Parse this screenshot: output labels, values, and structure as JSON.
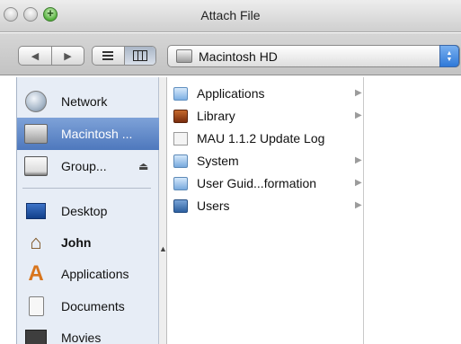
{
  "window": {
    "title": "Attach File"
  },
  "toolbar": {
    "back_glyph": "◀",
    "forward_glyph": "▶",
    "location": "Macintosh HD",
    "stepper_up": "▲",
    "stepper_down": "▼"
  },
  "sidebar": {
    "items": [
      {
        "label": "Network",
        "icon": "network-globe-icon"
      },
      {
        "label": "Macintosh ...",
        "icon": "hard-drive-icon",
        "selected": true
      },
      {
        "label": "Group...",
        "icon": "external-drive-icon",
        "eject": "⏏"
      },
      {
        "label": "Desktop",
        "icon": "desktop-icon"
      },
      {
        "label": "John",
        "icon": "home-icon"
      },
      {
        "label": "Applications",
        "icon": "applications-icon"
      },
      {
        "label": "Documents",
        "icon": "documents-icon"
      },
      {
        "label": "Movies",
        "icon": "movies-icon"
      }
    ]
  },
  "column": {
    "items": [
      {
        "label": "Applications",
        "icon": "applications-folder-icon",
        "has_children": true
      },
      {
        "label": "Library",
        "icon": "library-folder-icon",
        "has_children": true
      },
      {
        "label": "MAU 1.1.2 Update Log",
        "icon": "log-document-icon",
        "has_children": false
      },
      {
        "label": "System",
        "icon": "system-folder-icon",
        "has_children": true
      },
      {
        "label": "User Guid...formation",
        "icon": "user-guide-folder-icon",
        "has_children": true
      },
      {
        "label": "Users",
        "icon": "users-folder-icon",
        "has_children": true
      }
    ],
    "arrow_glyph": "▶"
  },
  "colors": {
    "selection": "#5a82c4",
    "sidebar_bg": "#e7edf6",
    "zoom_button": "#54b03c"
  }
}
